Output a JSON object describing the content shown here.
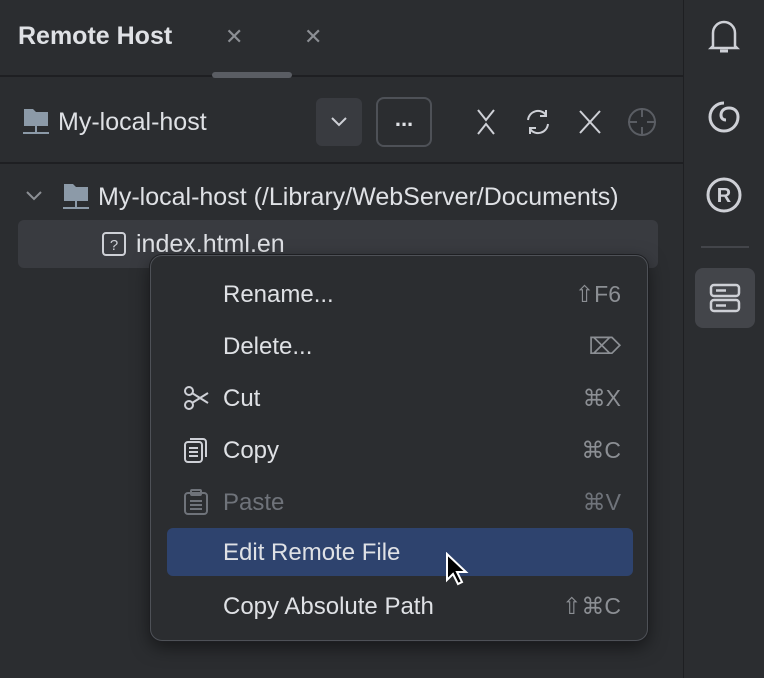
{
  "header": {
    "title": "Remote Host"
  },
  "toolbar": {
    "host": "My-local-host",
    "more_label": "..."
  },
  "tree": {
    "root": "My-local-host (/Library/WebServer/Documents)",
    "file": "index.html.en"
  },
  "menu": {
    "items": [
      {
        "label": "Rename...",
        "shortcut": "⇧F6"
      },
      {
        "label": "Delete...",
        "shortcut": "⌦"
      },
      {
        "label": "Cut",
        "shortcut": "⌘X"
      },
      {
        "label": "Copy",
        "shortcut": "⌘C"
      },
      {
        "label": "Paste",
        "shortcut": "⌘V"
      },
      {
        "label": "Edit Remote File",
        "shortcut": ""
      },
      {
        "label": "Copy Absolute Path",
        "shortcut": "⇧⌘C"
      }
    ]
  },
  "colors": {
    "background": "#2b2d30",
    "highlight": "#2e436e"
  }
}
